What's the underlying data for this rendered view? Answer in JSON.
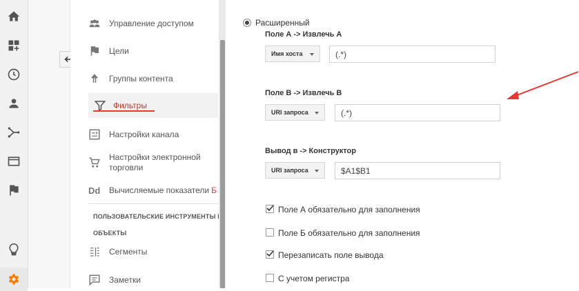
{
  "rail": {
    "icons": [
      "home-icon",
      "dashboard-customize-icon",
      "clock-icon",
      "person-icon",
      "acquisition-icon",
      "behavior-icon",
      "flag-icon",
      "lightbulb-icon",
      "gear-icon"
    ]
  },
  "nav": {
    "items": [
      {
        "label": "Управление доступом",
        "icon": "group-icon"
      },
      {
        "label": "Цели",
        "icon": "flag-icon"
      },
      {
        "label": "Группы контента",
        "icon": "content-group-icon"
      },
      {
        "label": "Фильтры",
        "icon": "filter-icon"
      },
      {
        "label": "Настройки канала",
        "icon": "channel-settings-icon"
      },
      {
        "label": "Настройки электронной торговли",
        "icon": "cart-icon"
      },
      {
        "label": "Вычисляемые показатели",
        "badge": "Б",
        "icon_text": "Dd"
      },
      {
        "label": "Сегменты",
        "icon": "segments-icon"
      },
      {
        "label": "Заметки",
        "icon": "notes-icon"
      }
    ],
    "section_personal_tools": "ПОЛЬЗОВАТЕЛЬСКИЕ ИНСТРУМЕНТЫ И",
    "section_objects": "ОБЪЕКТЫ"
  },
  "form": {
    "advanced_radio_label": "Расширенный",
    "field_a_label": "Поле А -> Извлечь А",
    "field_a_select": "Имя хоста",
    "field_a_value": "(.*)",
    "field_b_label": "Поле В -> Извлечь В",
    "field_b_select": "URI запроса",
    "field_b_value": "(.*)",
    "output_label": "Вывод в -> Конструктор",
    "output_select": "URI запроса",
    "output_value": "$A1$B1",
    "checkboxes": [
      {
        "label": "Поле А обязательно для заполнения",
        "checked": true
      },
      {
        "label": "Поле Б обязательно для заполнения",
        "checked": false
      },
      {
        "label": "Перезаписать поле вывода",
        "checked": true
      },
      {
        "label": "С учетом регистра",
        "checked": false
      }
    ]
  },
  "colors": {
    "accent_red": "#e53935",
    "active_gear": "#f57c00"
  }
}
